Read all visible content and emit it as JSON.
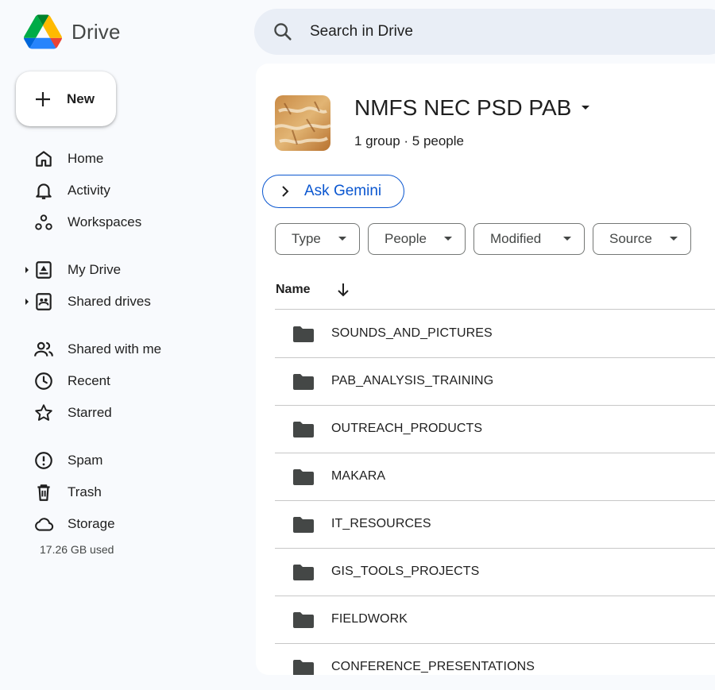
{
  "app": {
    "name": "Drive"
  },
  "search": {
    "placeholder": "Search in Drive"
  },
  "new_button": {
    "label": "New"
  },
  "sidebar": {
    "items": [
      {
        "label": "Home",
        "icon": "home-icon"
      },
      {
        "label": "Activity",
        "icon": "bell-icon"
      },
      {
        "label": "Workspaces",
        "icon": "workspaces-icon"
      },
      {
        "label": "My Drive",
        "icon": "my-drive-icon",
        "expandable": true
      },
      {
        "label": "Shared drives",
        "icon": "shared-drives-icon",
        "expandable": true
      },
      {
        "label": "Shared with me",
        "icon": "people-icon"
      },
      {
        "label": "Recent",
        "icon": "clock-icon"
      },
      {
        "label": "Starred",
        "icon": "star-icon"
      },
      {
        "label": "Spam",
        "icon": "spam-icon"
      },
      {
        "label": "Trash",
        "icon": "trash-icon"
      },
      {
        "label": "Storage",
        "icon": "cloud-icon"
      }
    ],
    "storage_used": "17.26 GB used"
  },
  "group": {
    "title": "NMFS NEC PSD PAB",
    "subtitle": "1 group · 5 people"
  },
  "gemini": {
    "label": "Ask Gemini"
  },
  "filters": [
    "Type",
    "People",
    "Modified",
    "Source"
  ],
  "list": {
    "column_name": "Name",
    "rows": [
      "SOUNDS_AND_PICTURES",
      "PAB_ANALYSIS_TRAINING",
      "OUTREACH_PRODUCTS",
      "MAKARA",
      "IT_RESOURCES",
      "GIS_TOOLS_PROJECTS",
      "FIELDWORK",
      "CONFERENCE_PRESENTATIONS"
    ]
  },
  "colors": {
    "accent_blue": "#0b57d0",
    "background": "#f8fafd",
    "search_bg": "#e9eef6",
    "folder": "#444746"
  }
}
